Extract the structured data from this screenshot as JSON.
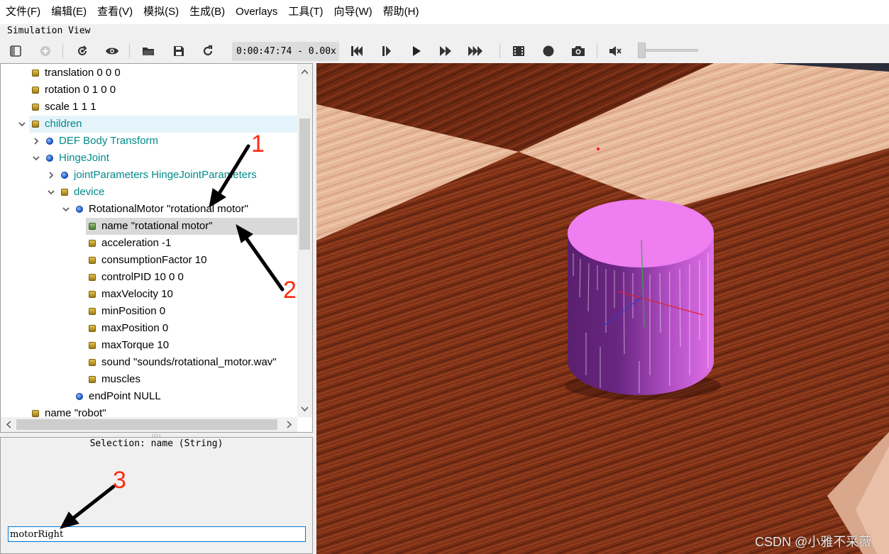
{
  "menu": [
    "文件(F)",
    "编辑(E)",
    "查看(V)",
    "模拟(S)",
    "生成(B)",
    "Overlays",
    "工具(T)",
    "向导(W)",
    "帮助(H)"
  ],
  "view_title": "Simulation View",
  "toolbar": {
    "time": "0:00:47:74 -  0.00x",
    "icons": [
      "panel-toggle-icon",
      "add-node-icon",
      "reload-world-icon",
      "show-icon",
      "open-icon",
      "save-icon",
      "reset-icon",
      "step-back-icon",
      "step-icon",
      "play-icon",
      "fast-forward-icon",
      "fastest-icon",
      "movie-icon",
      "record-icon",
      "screenshot-icon",
      "mute-icon"
    ],
    "volume": 0
  },
  "tree": {
    "rows": [
      {
        "label": "translation 0 0 0",
        "kind": "field"
      },
      {
        "label": "rotation 0 1 0 0",
        "kind": "field"
      },
      {
        "label": "scale 1 1 1",
        "kind": "field"
      },
      {
        "label": "children",
        "kind": "field"
      },
      {
        "label": "DEF Body Transform",
        "kind": "node"
      },
      {
        "label": "HingeJoint",
        "kind": "node"
      },
      {
        "label": "jointParameters HingeJointParameters",
        "kind": "node"
      },
      {
        "label": "device",
        "kind": "field"
      },
      {
        "label": "RotationalMotor \"rotational motor\"",
        "kind": "node"
      },
      {
        "label": "name \"rotational motor\"",
        "kind": "field"
      },
      {
        "label": "acceleration -1",
        "kind": "field"
      },
      {
        "label": "consumptionFactor 10",
        "kind": "field"
      },
      {
        "label": "controlPID 10 0 0",
        "kind": "field"
      },
      {
        "label": "maxVelocity 10",
        "kind": "field"
      },
      {
        "label": "minPosition 0",
        "kind": "field"
      },
      {
        "label": "maxPosition 0",
        "kind": "field"
      },
      {
        "label": "maxTorque 10",
        "kind": "field"
      },
      {
        "label": "sound \"sounds/rotational_motor.wav\"",
        "kind": "field"
      },
      {
        "label": "muscles",
        "kind": "field"
      },
      {
        "label": "endPoint NULL",
        "kind": "node"
      },
      {
        "label": "name \"robot\"",
        "kind": "field"
      }
    ]
  },
  "editor": {
    "selection": "Selection: name (String)",
    "value": "motorRight"
  },
  "annotations": [
    "1",
    "2",
    "3"
  ],
  "watermark": "CSDN @小雅不采薇",
  "colors": {
    "accent": "#0078d7",
    "node_text": "#008b8b",
    "annotation": "#ff2a10",
    "cylinder": "#e87ae8"
  }
}
